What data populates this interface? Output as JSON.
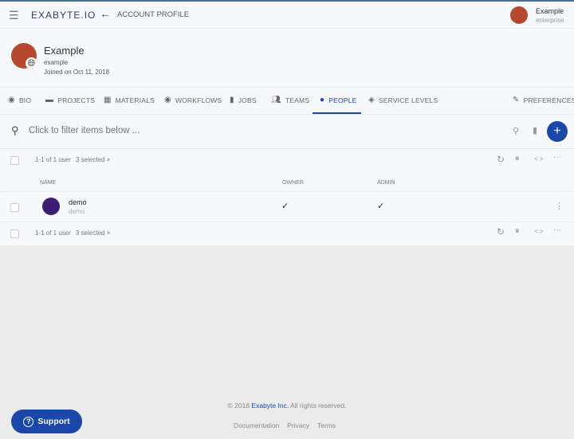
{
  "header": {
    "brand": "EXABYTE.IO",
    "title": "ACCOUNT PROFILE",
    "user_name": "Example",
    "user_plan": "enterprise"
  },
  "profile": {
    "name": "Example",
    "username": "example",
    "joined": "Joined on Oct 11, 2018"
  },
  "tabs": [
    {
      "label": "BIO",
      "icon": "eye-icon"
    },
    {
      "label": "PROJECTS",
      "icon": "folder-icon"
    },
    {
      "label": "MATERIALS",
      "icon": "grid-icon"
    },
    {
      "label": "WORKFLOWS",
      "icon": "radio-icon"
    },
    {
      "label": "JOBS",
      "icon": "file-icon"
    },
    {
      "label": "TEAMS",
      "icon": "group-icon"
    },
    {
      "label": "PEOPLE",
      "icon": "person-icon",
      "active": true
    },
    {
      "label": "SERVICE LEVELS",
      "icon": "layers-icon"
    },
    {
      "label": "PREFERENCES",
      "icon": "pencil-icon"
    }
  ],
  "filter": {
    "placeholder": "Click to filter items below ..."
  },
  "table": {
    "count": "1-1 of 1 user",
    "selected": "3 selected ×",
    "columns": [
      "NAME",
      "OWNER",
      "ADMIN"
    ],
    "rows": [
      {
        "name": "demo",
        "username": "demo",
        "owner": "✓",
        "admin": "✓"
      }
    ]
  },
  "footer": {
    "copyright_prefix": "© 2018 ",
    "company": "Exabyte Inc.",
    "copyright_suffix": " All rights reserved.",
    "links": [
      "Documentation",
      "Privacy",
      "Terms"
    ]
  },
  "support": {
    "label": "Support"
  },
  "colors": {
    "accent": "#1a47a8",
    "brand": "#2b3f6e"
  }
}
